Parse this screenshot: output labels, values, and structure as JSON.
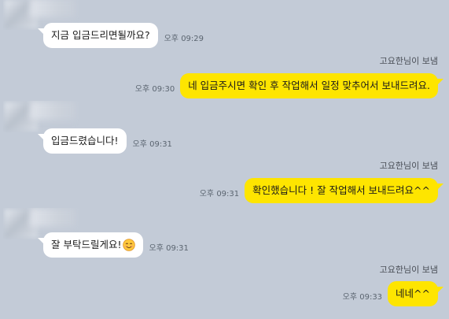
{
  "chat": {
    "sender_profile": {
      "avatar_icon": "blurred-profile-avatar"
    },
    "messages": [
      {
        "text": "지금 입금드리면될까요?",
        "time": "오후 09:29"
      },
      {
        "sender_label": "고요한님이 보냄",
        "text": "네 입금주시면 확인 후 작업해서 일정 맞추어서 보내드려요.",
        "time": "오후 09:30"
      },
      {
        "text": "입금드렸습니다!",
        "time": "오후 09:31"
      },
      {
        "sender_label": "고요한님이 보냄",
        "text": "확인했습니다 ! 잘 작업해서 보내드려요^^",
        "time": "오후 09:31"
      },
      {
        "text": "잘 부탁드릴게요!",
        "emoji_icon": "smiling-face-emoji-icon",
        "time": "오후 09:31"
      },
      {
        "sender_label": "고요한님이 보냄",
        "text": "네네^^",
        "time": "오후 09:33"
      }
    ]
  },
  "colors": {
    "background": "#c3cbd7",
    "sent_bubble": "#fee500",
    "received_bubble": "#ffffff",
    "time_text": "#5b6570",
    "label_text": "#4a4f57"
  }
}
